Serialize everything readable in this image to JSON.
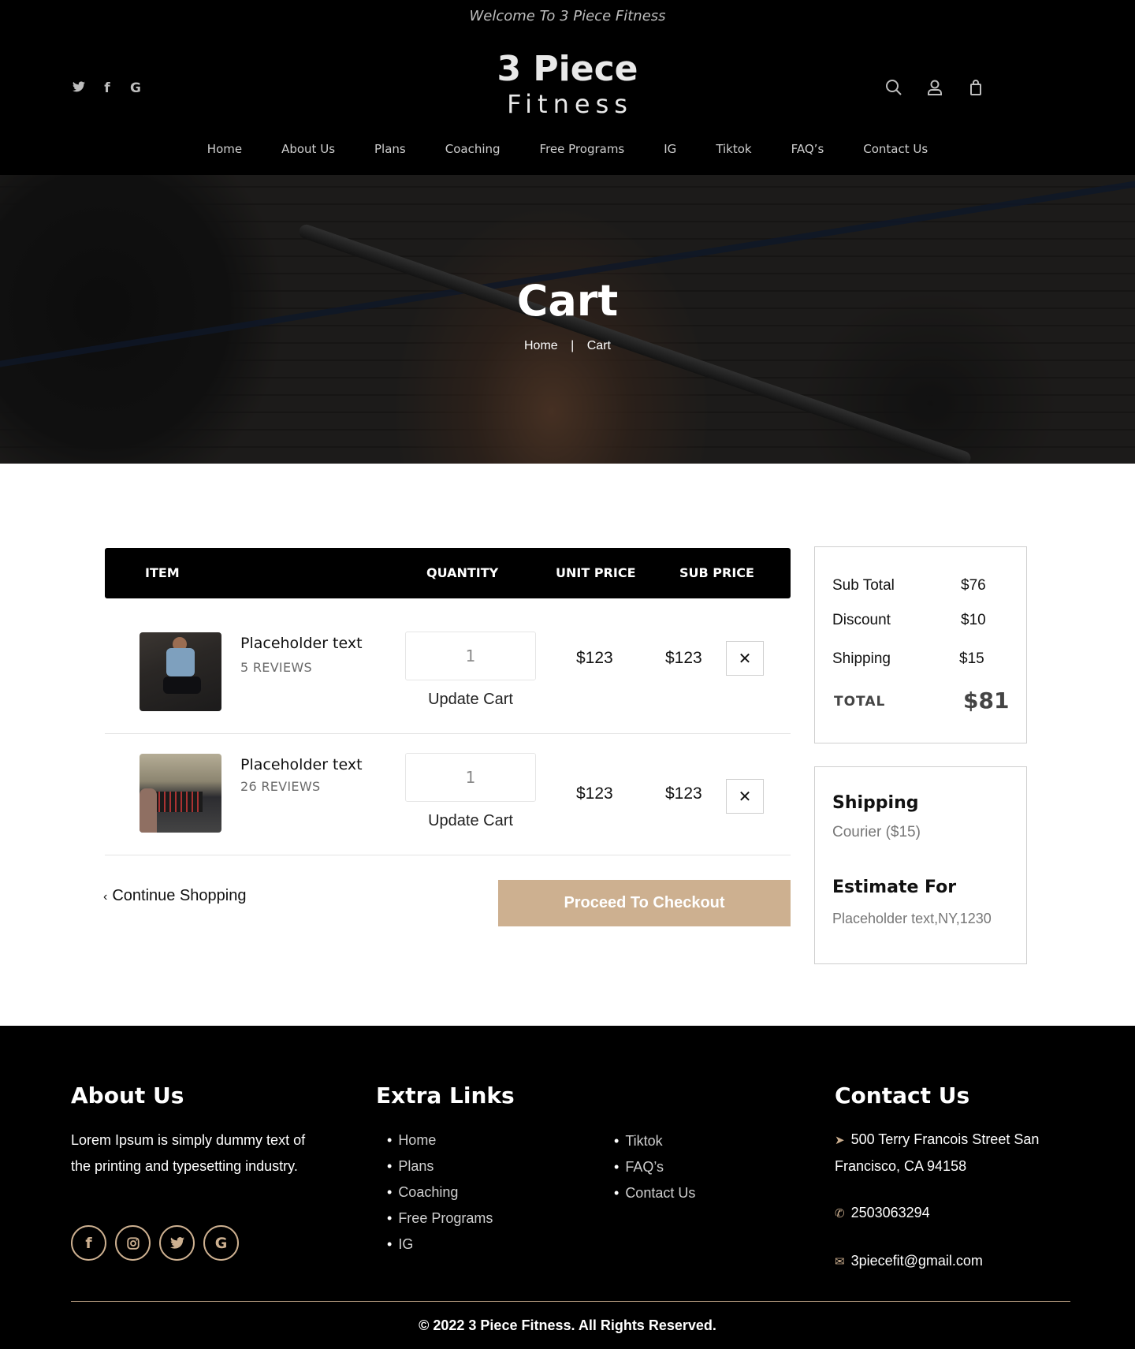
{
  "header": {
    "welcome": "Welcome To 3 Piece Fitness",
    "logo_line1": "3 Piece",
    "logo_line2": "Fitness",
    "social_icons": [
      "twitter-icon",
      "facebook-icon",
      "google-icon"
    ],
    "utility_icons": [
      "search-icon",
      "user-icon",
      "shopping-bag-icon"
    ],
    "nav": [
      "Home",
      "About Us",
      "Plans",
      "Coaching",
      "Free Programs",
      "IG",
      "Tiktok",
      "FAQ’s",
      "Contact Us"
    ]
  },
  "hero": {
    "title": "Cart",
    "breadcrumb": {
      "home": "Home",
      "separator": "|",
      "current": "Cart"
    }
  },
  "cart": {
    "columns": {
      "item": "ITEM",
      "quantity": "QUANTITY",
      "unit_price": "UNIT PRICE",
      "sub_price": "SUB PRICE"
    },
    "items": [
      {
        "name": "Placeholder text",
        "reviews": "5 REVIEWS",
        "quantity": "1",
        "update_label": "Update Cart",
        "unit_price": "$123",
        "sub_price": "$123",
        "remove_label": "✕"
      },
      {
        "name": "Placeholder text",
        "reviews": "26 REVIEWS",
        "quantity": "1",
        "update_label": "Update Cart",
        "unit_price": "$123",
        "sub_price": "$123",
        "remove_label": "✕"
      }
    ],
    "continue_label": "Continue Shopping",
    "checkout_label": "Proceed To Checkout"
  },
  "summary": {
    "subtotal_label": "Sub Total",
    "subtotal": "$76",
    "discount_label": "Discount",
    "discount": "$10",
    "shipping_label": "Shipping",
    "shipping": "$15",
    "total_label": "TOTAL",
    "total": "$81"
  },
  "shipping_box": {
    "heading": "Shipping",
    "method": "Courier ($15)",
    "estimate_heading": "Estimate For",
    "estimate_value": "Placeholder text,NY,1230"
  },
  "footer": {
    "about_heading": "About Us",
    "about_text": "Lorem Ipsum is simply dummy text of the printing and typesetting industry.",
    "social_icons": [
      "facebook-icon",
      "instagram-icon",
      "twitter-icon",
      "google-icon"
    ],
    "links_heading": "Extra Links",
    "links_col1": [
      "Home",
      "Plans",
      "Coaching",
      "Free Programs",
      "IG"
    ],
    "links_col2": [
      "Tiktok",
      "FAQ’s",
      "Contact Us"
    ],
    "contact_heading": "Contact Us",
    "address_line1": "500 Terry Francois Street San",
    "address_line2": "Francisco, CA 94158",
    "phone": "2503063294",
    "email": "3piecefit@gmail.com",
    "copyright": "© 2022 3 Piece Fitness. All Rights Reserved."
  },
  "colors": {
    "accent": "#cdb090",
    "header_bg": "#000000",
    "border": "#cfcfcf"
  }
}
